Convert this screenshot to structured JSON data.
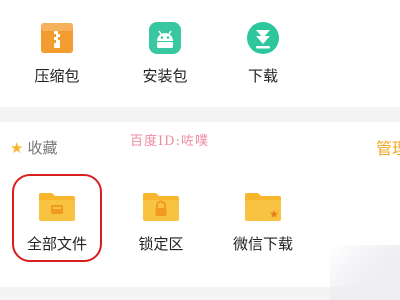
{
  "top_categories": [
    {
      "label": "压缩包",
      "icon": "archive-icon",
      "color": "#f39c2f"
    },
    {
      "label": "安装包",
      "icon": "android-icon",
      "color": "#38c7a0"
    },
    {
      "label": "下载",
      "icon": "download-icon",
      "color": "#2ec79d"
    }
  ],
  "favorites": {
    "title": "收藏",
    "manage_label": "管理",
    "items": [
      {
        "label": "全部文件",
        "icon": "folder-all-files-icon"
      },
      {
        "label": "锁定区",
        "icon": "folder-lock-icon"
      },
      {
        "label": "微信下载",
        "icon": "folder-star-icon"
      }
    ]
  },
  "watermark": "百度ID:咗噗",
  "colors": {
    "folder": "#f7b52c",
    "accent": "#f5a623",
    "highlight": "#d81e1e"
  }
}
